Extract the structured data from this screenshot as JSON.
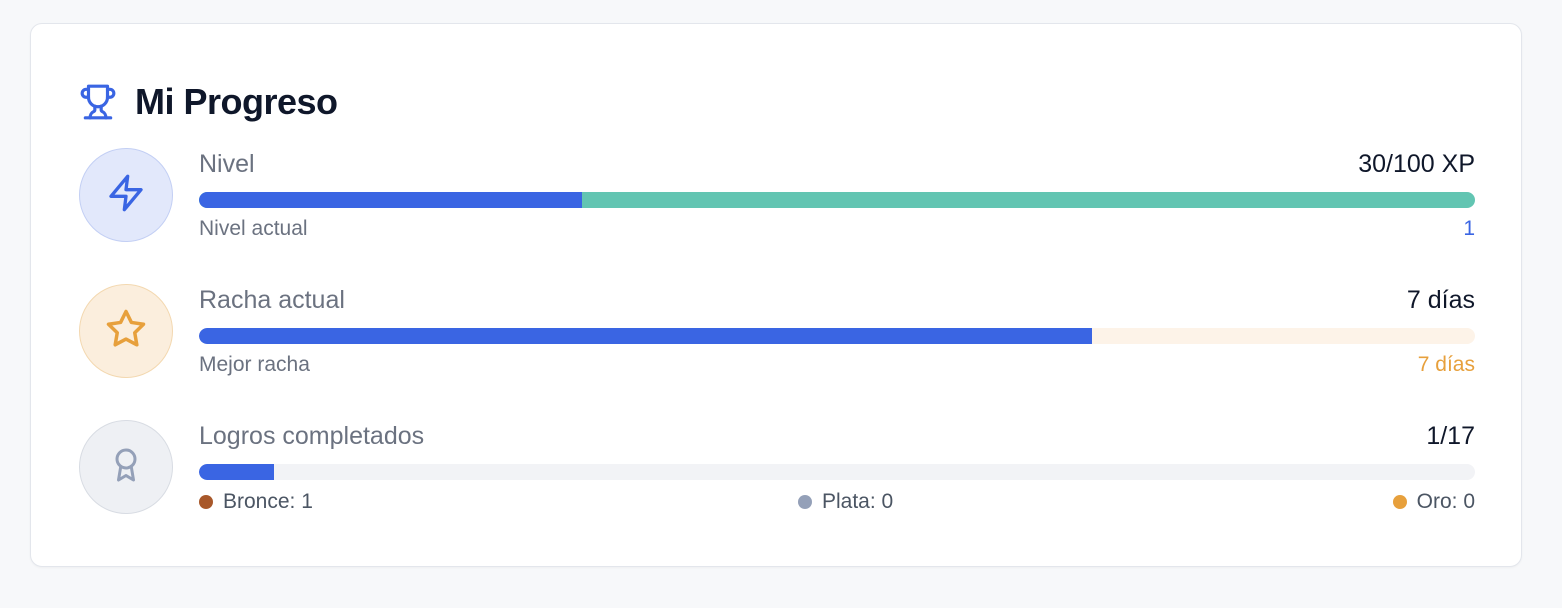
{
  "header": {
    "icon": "trophy-icon",
    "title": "Mi Progreso"
  },
  "colors": {
    "accent": "#3a65e3",
    "level_track": "#62c5b2",
    "streak_track": "#fdf3e8",
    "achievements_track": "#f2f3f6",
    "level_value": "#3a65e3",
    "streak_value": "#e7a03c",
    "bronze": "#a8582a",
    "silver": "#94a0b8",
    "gold": "#e7a03c"
  },
  "level": {
    "icon": "lightning-icon",
    "label": "Nivel",
    "value": "30/100 XP",
    "progress_percent": 30,
    "sub_label": "Nivel actual",
    "sub_value": "1"
  },
  "streak": {
    "icon": "star-icon",
    "label": "Racha actual",
    "value": "7 días",
    "progress_percent": 70,
    "sub_label": "Mejor racha",
    "sub_value": "7 días"
  },
  "achievements": {
    "icon": "award-icon",
    "label": "Logros completados",
    "value": "1/17",
    "progress_fraction": "1/17",
    "medals": [
      {
        "name": "bronze",
        "label": "Bronce: 1"
      },
      {
        "name": "silver",
        "label": "Plata: 0"
      },
      {
        "name": "gold",
        "label": "Oro: 0"
      }
    ]
  }
}
